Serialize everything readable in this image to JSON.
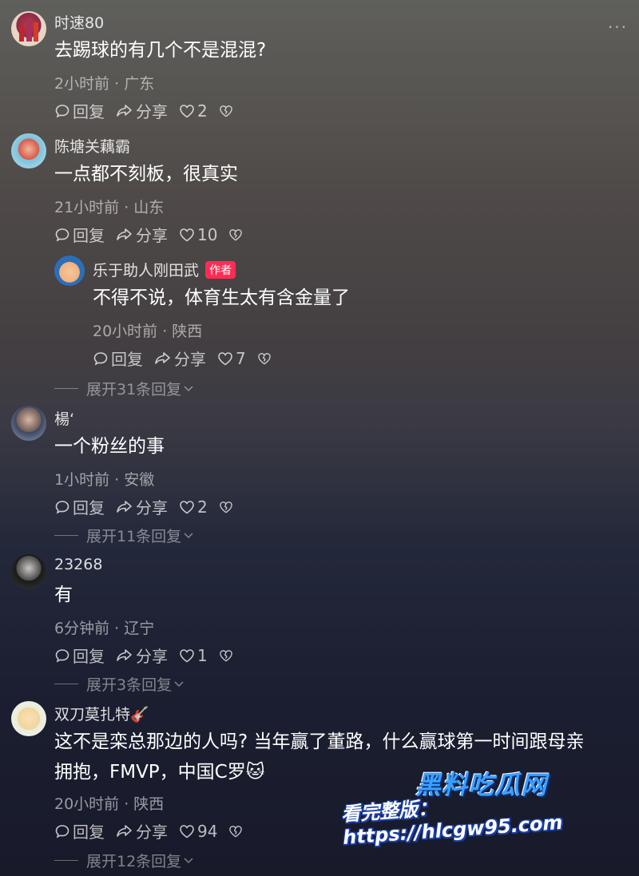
{
  "ui": {
    "more_label": "···",
    "reply_label": "回复",
    "share_label": "分享",
    "author_badge": "作者"
  },
  "comments": [
    {
      "user": "时速80",
      "text": "去踢球的有几个不是混混?",
      "meta": "2小时前 · 广东",
      "likes": "2"
    },
    {
      "user": "陈塘关藕霸",
      "text": "一点都不刻板，很真实",
      "meta": "21小时前 · 山东",
      "likes": "10",
      "reply": {
        "user": "乐于助人刚田武",
        "text": "不得不说，体育生太有含金量了",
        "meta": "20小时前 · 陕西",
        "likes": "7"
      },
      "expand": "展开31条回复"
    },
    {
      "user": "楊‘",
      "text": "一个粉丝的事",
      "meta": "1小时前 · 安徽",
      "likes": "2",
      "expand": "展开11条回复"
    },
    {
      "user": "23268",
      "text": "有",
      "meta": "6分钟前 · 辽宁",
      "likes": "1",
      "expand": "展开3条回复"
    },
    {
      "user": "双刀莫扎特🎸",
      "text_line1": "这不是栾总那边的人吗? 当年赢了董路，什么赢球第一时间跟母亲",
      "text_line2": "拥抱，FMVP，中国C罗🐱",
      "meta": "20小时前 · 陕西",
      "likes": "94",
      "expand": "展开12条回复"
    }
  ],
  "watermark": {
    "brand": "黑料吃瓜网",
    "url_text": "看完整版：https://hlcgw95.com"
  }
}
